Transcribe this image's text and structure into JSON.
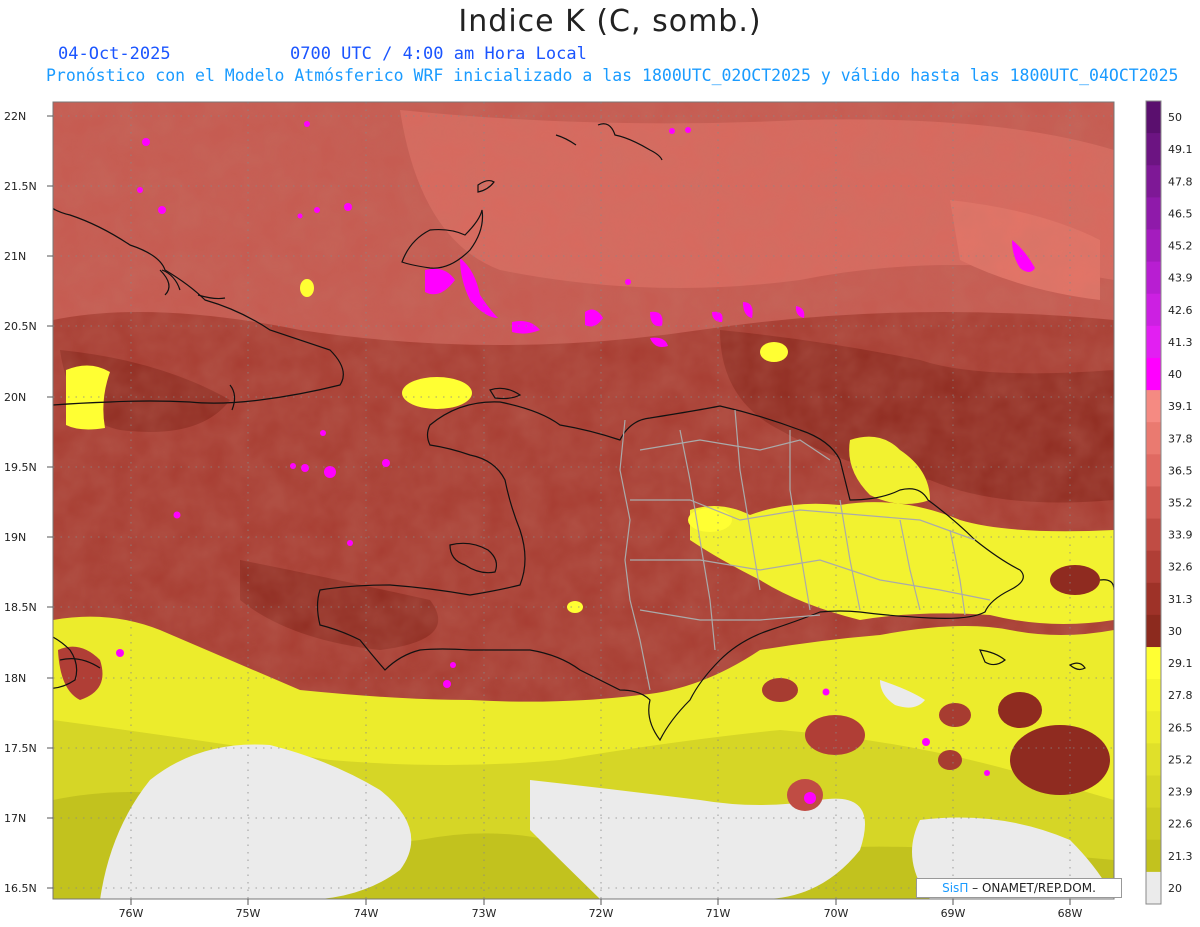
{
  "header": {
    "title": "Indice K (C, somb.)",
    "date": "04-Oct-2025",
    "time": "0700 UTC / 4:00 am Hora Local",
    "subtitle": "Pronóstico con el Modelo Atmósferico WRF inicializado a las 1800UTC_02OCT2025 y válido hasta las  1800UTC_04OCT2025"
  },
  "axes": {
    "lat_labels": [
      "22N",
      "21.5N",
      "21N",
      "20.5N",
      "20N",
      "19.5N",
      "19N",
      "18.5N",
      "18N",
      "17.5N",
      "17N",
      "16.5N"
    ],
    "lon_labels": [
      "76W",
      "75W",
      "74W",
      "73W",
      "72W",
      "71W",
      "70W",
      "69W",
      "68W"
    ]
  },
  "legend": {
    "levels": [
      "50",
      "49.1",
      "47.8",
      "46.5",
      "45.2",
      "43.9",
      "42.6",
      "41.3",
      "40",
      "39.1",
      "37.8",
      "36.5",
      "35.2",
      "33.9",
      "32.6",
      "31.3",
      "30",
      "29.1",
      "27.8",
      "26.5",
      "25.2",
      "23.9",
      "22.6",
      "21.3",
      "20"
    ],
    "colors": [
      "#5a0f6e",
      "#6c1482",
      "#7e1896",
      "#8f1aaa",
      "#a41cbe",
      "#b81ed2",
      "#cc20e2",
      "#e21ff2",
      "#ff00ff",
      "#f58a82",
      "#ea7a70",
      "#e06a62",
      "#d05a52",
      "#c04c44",
      "#b03e36",
      "#9e3228",
      "#8c2a1e",
      "#ffff33",
      "#f5f52e",
      "#ecec2c",
      "#e0e02a",
      "#d6d626",
      "#cccc22",
      "#c2c21e",
      "#ebebeb"
    ]
  },
  "credit": {
    "brand": "SisΠ",
    "text": "– ONAMET/REP.DOM."
  }
}
